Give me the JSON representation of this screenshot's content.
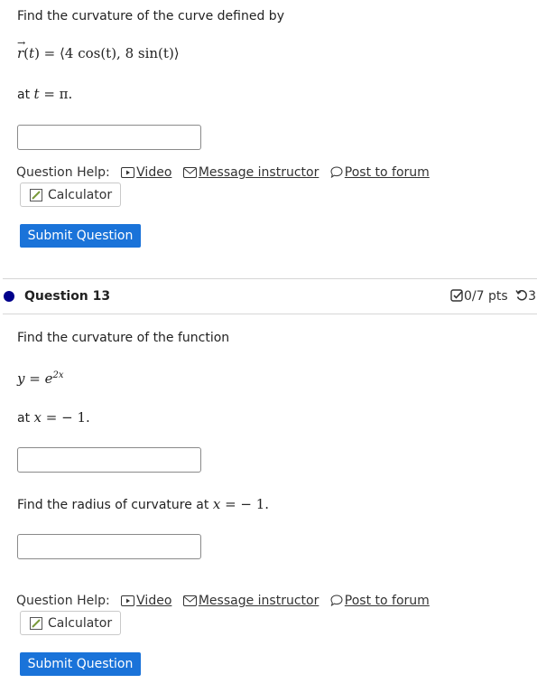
{
  "q12": {
    "prompt": "Find the curvature of the curve defined by",
    "expr_lhs": "r(t)",
    "expr_rhs": "⟨4 cos(t), 8 sin(t)⟩",
    "at_prefix": "at",
    "at_var": "t",
    "at_value": "π."
  },
  "q13": {
    "status_dot_color": "#00008b",
    "title": "Question 13",
    "points": "0/7 pts",
    "attempts_partial": "3",
    "prompt": "Find the curvature of the function",
    "func_lhs": "y",
    "func_base": "e",
    "func_exp": "2x",
    "at_prefix": "at",
    "at_var": "x",
    "at_value": "− 1.",
    "radius_prompt": "Find the radius of curvature at",
    "radius_var": "x",
    "radius_value": "− 1."
  },
  "help": {
    "label": "Question Help:",
    "video": "Video",
    "message": "Message instructor",
    "forum": "Post to forum"
  },
  "buttons": {
    "calculator": "Calculator",
    "submit": "Submit Question"
  },
  "colors": {
    "accent": "#1a73d9"
  }
}
